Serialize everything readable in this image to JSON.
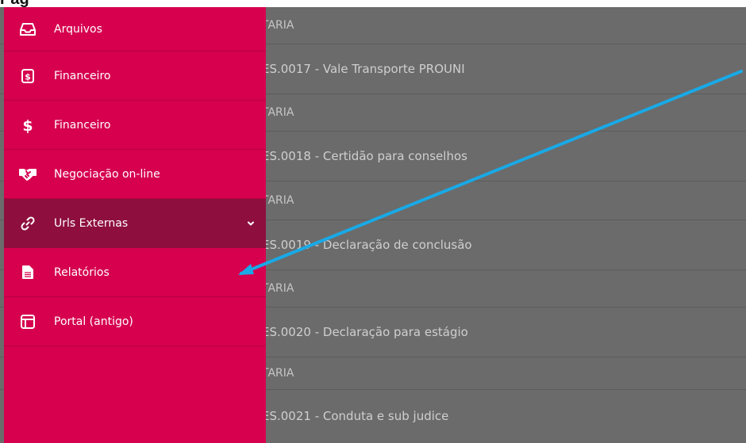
{
  "header": {
    "cut_title": "Pág"
  },
  "content_rows": [
    {
      "text": "TARIA",
      "small": true
    },
    {
      "text": "ES.0017 - Vale Transporte PROUNI",
      "small": false
    },
    {
      "text": "TARIA",
      "small": true
    },
    {
      "text": "ES.0018 - Certidão para conselhos",
      "small": false
    },
    {
      "text": "TARIA",
      "small": true
    },
    {
      "text": "ES.0019 - Declaração de conclusão",
      "small": false
    },
    {
      "text": "TARIA",
      "small": true
    },
    {
      "text": "ES.0020 - Declaração para estágio",
      "small": false
    },
    {
      "text": "TARIA",
      "small": true
    },
    {
      "text": "ES.0021 - Conduta e sub judice",
      "small": false
    }
  ],
  "sidebar": {
    "items": [
      {
        "label": "Arquivos",
        "icon": "inbox-icon"
      },
      {
        "label": "Financeiro",
        "icon": "dollar-document-icon"
      },
      {
        "label": "Financeiro",
        "icon": "dollar-icon"
      },
      {
        "label": "Negociação on-line",
        "icon": "handshake-icon"
      },
      {
        "label": "Urls Externas",
        "icon": "link-icon",
        "active": true,
        "expandable": true
      },
      {
        "label": "Relatórios",
        "icon": "report-document-icon"
      },
      {
        "label": "Portal (antigo)",
        "icon": "layout-icon"
      }
    ]
  },
  "colors": {
    "sidebar_bg": "#d6004f",
    "sidebar_active": "#8e0f3e",
    "overlay_bg": "#6b6b6b",
    "arrow": "#19a9e6"
  }
}
